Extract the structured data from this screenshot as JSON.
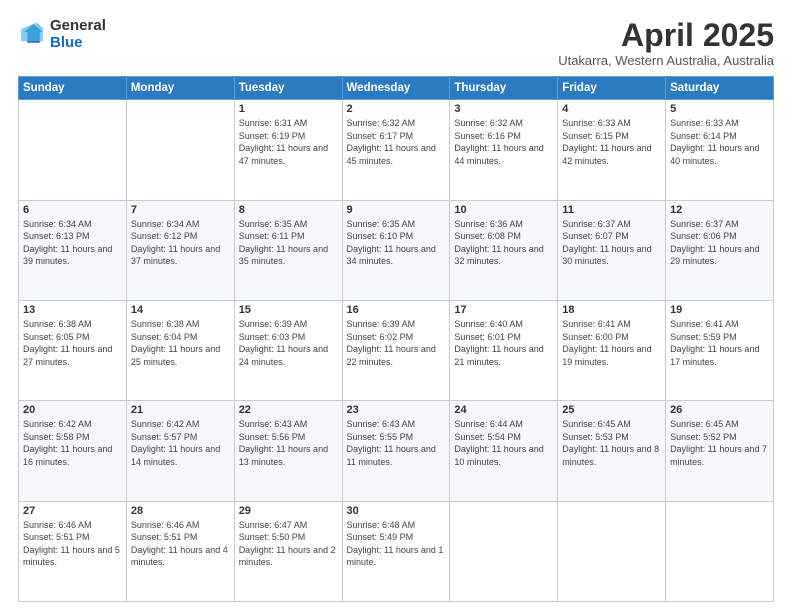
{
  "logo": {
    "general": "General",
    "blue": "Blue"
  },
  "title": {
    "month": "April 2025",
    "location": "Utakarra, Western Australia, Australia"
  },
  "days_of_week": [
    "Sunday",
    "Monday",
    "Tuesday",
    "Wednesday",
    "Thursday",
    "Friday",
    "Saturday"
  ],
  "weeks": [
    [
      {
        "day": "",
        "info": ""
      },
      {
        "day": "",
        "info": ""
      },
      {
        "day": "1",
        "info": "Sunrise: 6:31 AM\nSunset: 6:19 PM\nDaylight: 11 hours and 47 minutes."
      },
      {
        "day": "2",
        "info": "Sunrise: 6:32 AM\nSunset: 6:17 PM\nDaylight: 11 hours and 45 minutes."
      },
      {
        "day": "3",
        "info": "Sunrise: 6:32 AM\nSunset: 6:16 PM\nDaylight: 11 hours and 44 minutes."
      },
      {
        "day": "4",
        "info": "Sunrise: 6:33 AM\nSunset: 6:15 PM\nDaylight: 11 hours and 42 minutes."
      },
      {
        "day": "5",
        "info": "Sunrise: 6:33 AM\nSunset: 6:14 PM\nDaylight: 11 hours and 40 minutes."
      }
    ],
    [
      {
        "day": "6",
        "info": "Sunrise: 6:34 AM\nSunset: 6:13 PM\nDaylight: 11 hours and 39 minutes."
      },
      {
        "day": "7",
        "info": "Sunrise: 6:34 AM\nSunset: 6:12 PM\nDaylight: 11 hours and 37 minutes."
      },
      {
        "day": "8",
        "info": "Sunrise: 6:35 AM\nSunset: 6:11 PM\nDaylight: 11 hours and 35 minutes."
      },
      {
        "day": "9",
        "info": "Sunrise: 6:35 AM\nSunset: 6:10 PM\nDaylight: 11 hours and 34 minutes."
      },
      {
        "day": "10",
        "info": "Sunrise: 6:36 AM\nSunset: 6:08 PM\nDaylight: 11 hours and 32 minutes."
      },
      {
        "day": "11",
        "info": "Sunrise: 6:37 AM\nSunset: 6:07 PM\nDaylight: 11 hours and 30 minutes."
      },
      {
        "day": "12",
        "info": "Sunrise: 6:37 AM\nSunset: 6:06 PM\nDaylight: 11 hours and 29 minutes."
      }
    ],
    [
      {
        "day": "13",
        "info": "Sunrise: 6:38 AM\nSunset: 6:05 PM\nDaylight: 11 hours and 27 minutes."
      },
      {
        "day": "14",
        "info": "Sunrise: 6:38 AM\nSunset: 6:04 PM\nDaylight: 11 hours and 25 minutes."
      },
      {
        "day": "15",
        "info": "Sunrise: 6:39 AM\nSunset: 6:03 PM\nDaylight: 11 hours and 24 minutes."
      },
      {
        "day": "16",
        "info": "Sunrise: 6:39 AM\nSunset: 6:02 PM\nDaylight: 11 hours and 22 minutes."
      },
      {
        "day": "17",
        "info": "Sunrise: 6:40 AM\nSunset: 6:01 PM\nDaylight: 11 hours and 21 minutes."
      },
      {
        "day": "18",
        "info": "Sunrise: 6:41 AM\nSunset: 6:00 PM\nDaylight: 11 hours and 19 minutes."
      },
      {
        "day": "19",
        "info": "Sunrise: 6:41 AM\nSunset: 5:59 PM\nDaylight: 11 hours and 17 minutes."
      }
    ],
    [
      {
        "day": "20",
        "info": "Sunrise: 6:42 AM\nSunset: 5:58 PM\nDaylight: 11 hours and 16 minutes."
      },
      {
        "day": "21",
        "info": "Sunrise: 6:42 AM\nSunset: 5:57 PM\nDaylight: 11 hours and 14 minutes."
      },
      {
        "day": "22",
        "info": "Sunrise: 6:43 AM\nSunset: 5:56 PM\nDaylight: 11 hours and 13 minutes."
      },
      {
        "day": "23",
        "info": "Sunrise: 6:43 AM\nSunset: 5:55 PM\nDaylight: 11 hours and 11 minutes."
      },
      {
        "day": "24",
        "info": "Sunrise: 6:44 AM\nSunset: 5:54 PM\nDaylight: 11 hours and 10 minutes."
      },
      {
        "day": "25",
        "info": "Sunrise: 6:45 AM\nSunset: 5:53 PM\nDaylight: 11 hours and 8 minutes."
      },
      {
        "day": "26",
        "info": "Sunrise: 6:45 AM\nSunset: 5:52 PM\nDaylight: 11 hours and 7 minutes."
      }
    ],
    [
      {
        "day": "27",
        "info": "Sunrise: 6:46 AM\nSunset: 5:51 PM\nDaylight: 11 hours and 5 minutes."
      },
      {
        "day": "28",
        "info": "Sunrise: 6:46 AM\nSunset: 5:51 PM\nDaylight: 11 hours and 4 minutes."
      },
      {
        "day": "29",
        "info": "Sunrise: 6:47 AM\nSunset: 5:50 PM\nDaylight: 11 hours and 2 minutes."
      },
      {
        "day": "30",
        "info": "Sunrise: 6:48 AM\nSunset: 5:49 PM\nDaylight: 11 hours and 1 minute."
      },
      {
        "day": "",
        "info": ""
      },
      {
        "day": "",
        "info": ""
      },
      {
        "day": "",
        "info": ""
      }
    ]
  ]
}
